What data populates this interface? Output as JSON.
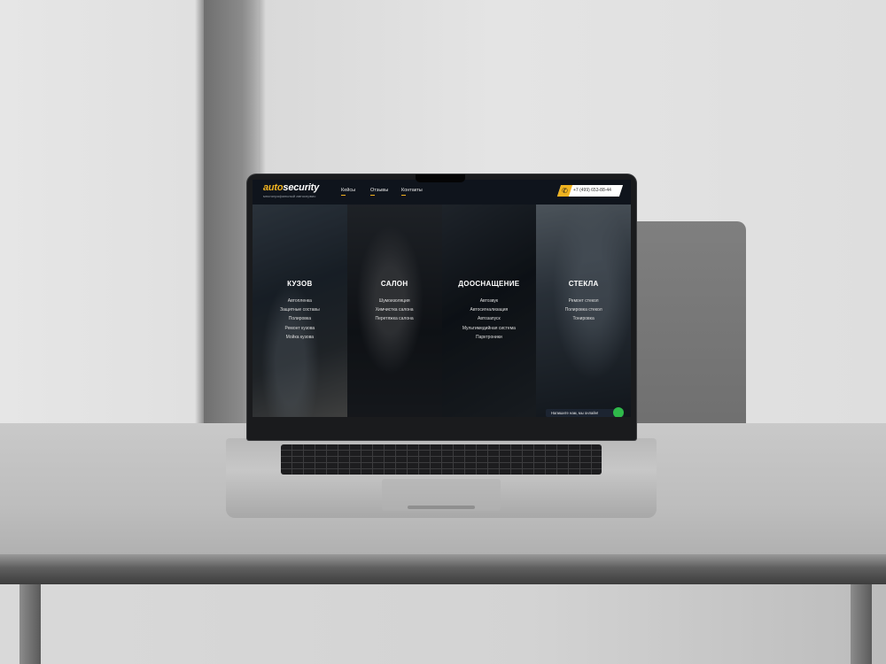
{
  "site": {
    "logo_part1": "auto",
    "logo_part2": "security",
    "tagline": "многопрофильный автосервис",
    "nav": [
      "Кейсы",
      "Отзывы",
      "Контакты"
    ],
    "phone": "+7 (499) 653-88-44",
    "phone_icon": "phone-icon"
  },
  "columns": [
    {
      "title": "КУЗОВ",
      "items": [
        "Автопленка",
        "Защитные составы",
        "Полировка",
        "Ремонт кузова",
        "Мойка кузова"
      ]
    },
    {
      "title": "САЛОН",
      "items": [
        "Шумоизоляция",
        "Химчистка салона",
        "Перетяжка салона"
      ]
    },
    {
      "title": "ДООСНАЩЕНИЕ",
      "items": [
        "Автозвук",
        "Автосигнализация",
        "Автозапуск",
        "Мультимедийная система",
        "Парктроники"
      ]
    },
    {
      "title": "СТЕКЛА",
      "items": [
        "Ремонт стекол",
        "Полировка стекол",
        "Тонировка"
      ]
    }
  ],
  "chat": {
    "label": "Напишите нам, мы онлайн!"
  },
  "colors": {
    "accent": "#f0b320",
    "background": "#151a22",
    "chat_online": "#2fb94a"
  }
}
